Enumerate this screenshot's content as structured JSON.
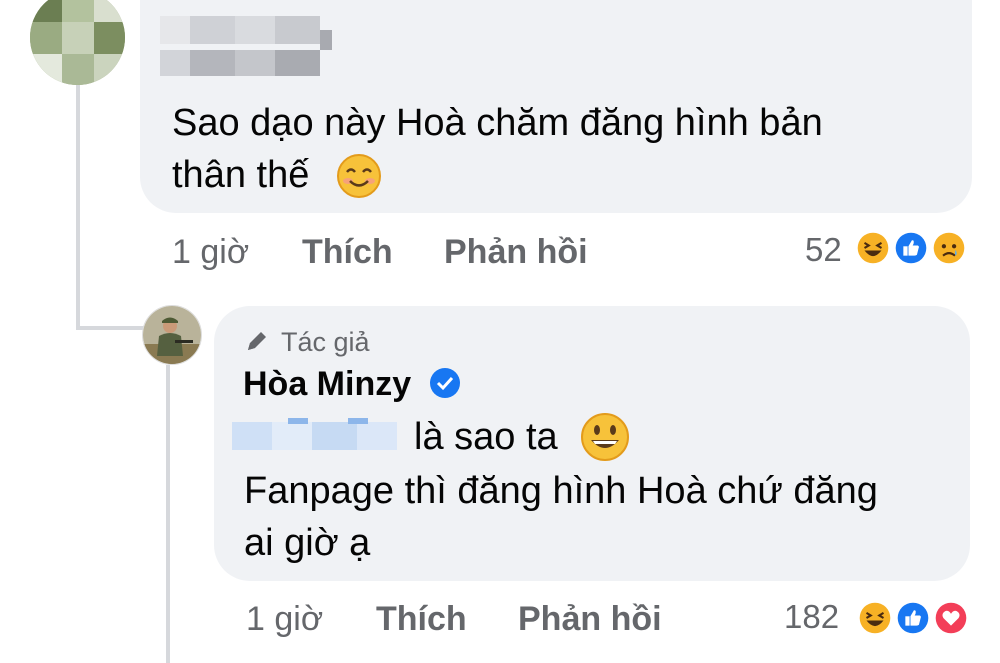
{
  "comment": {
    "text_line1": "Sao dạo này Hoà chăm đăng hình bản",
    "text_line2": "thân thế",
    "emoji_icon": "smiling-face-icon",
    "actions": {
      "time": "1 giờ",
      "like": "Thích",
      "reply": "Phản hồi"
    },
    "reaction_count": "52",
    "reactions": [
      "haha-icon",
      "like-icon",
      "sad-icon"
    ]
  },
  "reply": {
    "badge": "Tác giả",
    "author": "Hòa Minzy",
    "mention_suffix": "là sao ta",
    "text_line2": "Fanpage thì đăng hình Hoà chứ đăng",
    "text_line3": "ai giờ ạ",
    "actions": {
      "time": "1 giờ",
      "like": "Thích",
      "reply": "Phản hồi"
    },
    "reaction_count": "182",
    "reactions": [
      "haha-icon",
      "like-icon",
      "love-icon"
    ]
  },
  "colors": {
    "bubble": "#f0f2f5",
    "secondary_text": "#65676b",
    "verified_blue": "#1877f2",
    "like_blue": "#1877f2",
    "love_red": "#f33e58",
    "haha_yellow": "#f7b125"
  }
}
